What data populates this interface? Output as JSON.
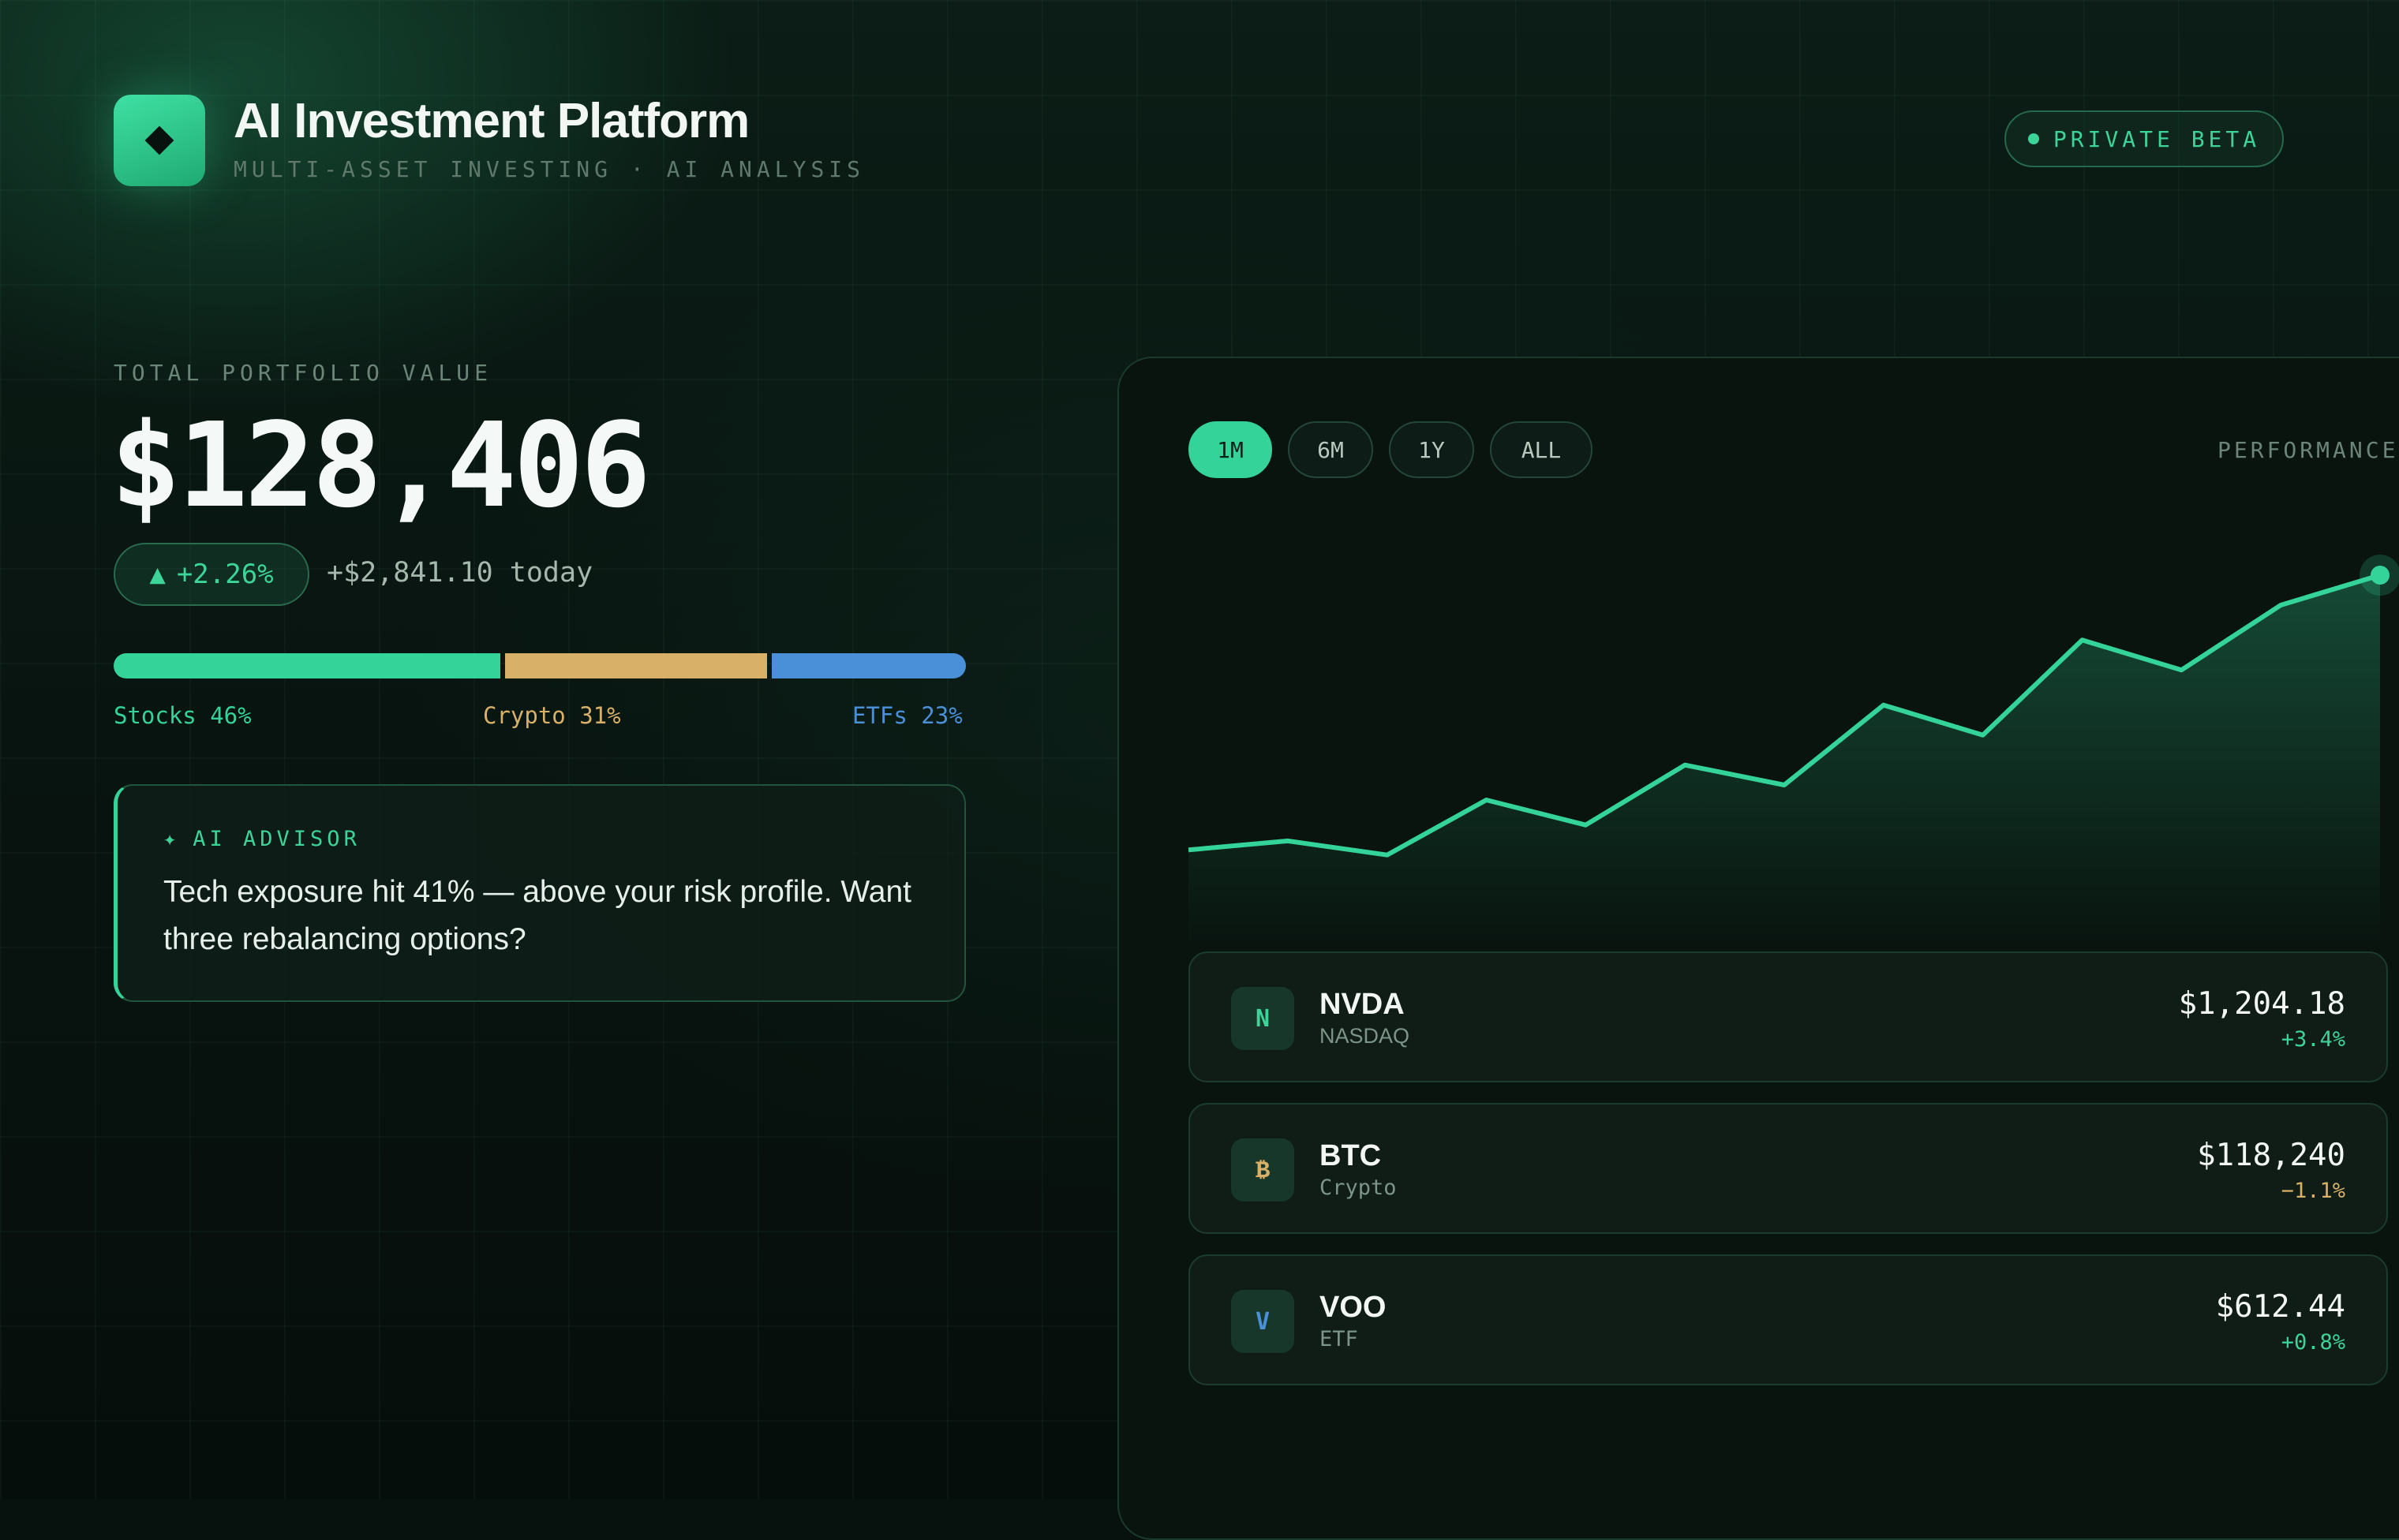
{
  "header": {
    "title": "AI Investment Platform",
    "subtitle": "MULTI-ASSET INVESTING · AI ANALYSIS",
    "logo_icon": "diamond-icon",
    "badge": "PRIVATE BETA"
  },
  "portfolio": {
    "label": "TOTAL PORTFOLIO VALUE",
    "value": "$128,406",
    "change_icon": "▲",
    "change_pct": "+2.26%",
    "today": "+$2,841.10 today"
  },
  "allocation": [
    {
      "label": "Stocks 46%",
      "percent": 46,
      "color": "#34d399"
    },
    {
      "label": "Crypto 31%",
      "percent": 31,
      "color": "#d8b068"
    },
    {
      "label": "ETFs 23%",
      "percent": 23,
      "color": "#4a90d9"
    }
  ],
  "advisor": {
    "icon": "✦",
    "tag": "AI ADVISOR",
    "message": "Tech exposure hit 41% — above your risk profile. Want three rebalancing options?"
  },
  "timeframes": [
    {
      "label": "1M",
      "active": true
    },
    {
      "label": "6M",
      "active": false
    },
    {
      "label": "1Y",
      "active": false
    },
    {
      "label": "ALL",
      "active": false
    }
  ],
  "performance_label": "PERFORMANCE",
  "chart_data": {
    "type": "area",
    "series": [
      {
        "values": [
          1.0,
          1.9,
          0.5,
          6.0,
          3.5,
          9.5,
          7.5,
          15.5,
          12.5,
          22.0,
          19.0,
          25.5,
          28.5
        ]
      }
    ],
    "line_color": "#34d399",
    "grid": false
  },
  "holdings": [
    {
      "badge": "N",
      "badge_color": "#3dd49a",
      "ticker": "NVDA",
      "exchange": "NASDAQ",
      "price": "$1,204.18",
      "change": "+3.4%",
      "change_color": "#3dd49a"
    },
    {
      "badge": "₿",
      "badge_color": "#d8b068",
      "ticker": "BTC",
      "exchange": "Crypto",
      "price": "$118,240",
      "change": "−1.1%",
      "change_color": "#d8b068"
    },
    {
      "badge": "V",
      "badge_color": "#4a90d9",
      "ticker": "VOO",
      "exchange": "ETF",
      "price": "$612.44",
      "change": "+0.8%",
      "change_color": "#3dd49a"
    }
  ]
}
